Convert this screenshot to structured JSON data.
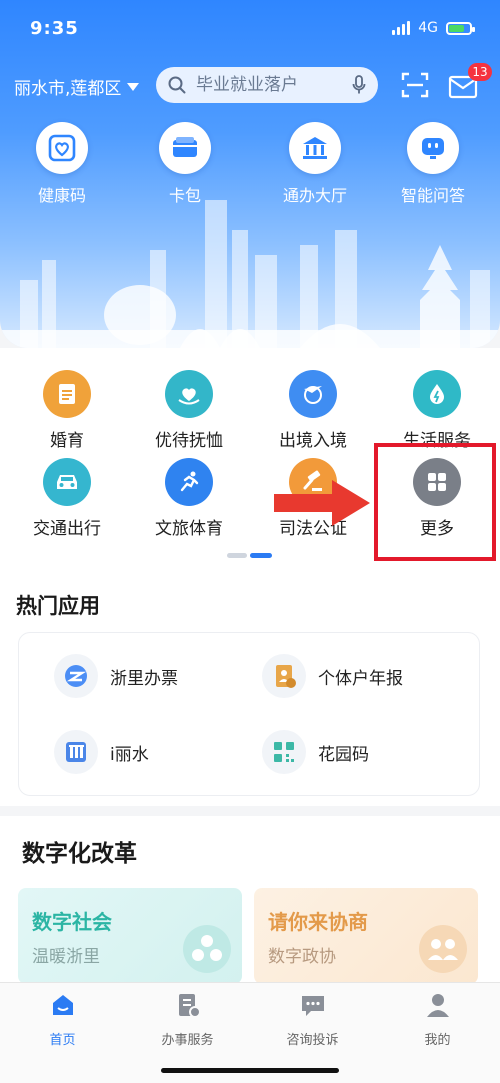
{
  "status_bar": {
    "time": "9:35",
    "network": "4G"
  },
  "header": {
    "city": "丽水市,莲都区",
    "search_placeholder": "毕业就业落户",
    "mail_badge": "13"
  },
  "quick_actions": [
    {
      "label": "健康码",
      "icon": "health-code-icon"
    },
    {
      "label": "卡包",
      "icon": "card-wallet-icon"
    },
    {
      "label": "通办大厅",
      "icon": "service-hall-icon"
    },
    {
      "label": "智能问答",
      "icon": "chatbot-icon"
    }
  ],
  "services": [
    {
      "label": "婚育",
      "icon": "marriage-icon",
      "color": "#f0a23a"
    },
    {
      "label": "优待抚恤",
      "icon": "care-heart-icon",
      "color": "#33b6c9"
    },
    {
      "label": "出境入境",
      "icon": "plane-globe-icon",
      "color": "#3f8df2"
    },
    {
      "label": "生活服务",
      "icon": "water-drop-icon",
      "color": "#2fb9c7"
    },
    {
      "label": "交通出行",
      "icon": "car-icon",
      "color": "#35b6cf"
    },
    {
      "label": "文旅体育",
      "icon": "runner-icon",
      "color": "#2f83f0"
    },
    {
      "label": "司法公证",
      "icon": "gavel-icon",
      "color": "#f29a3a"
    },
    {
      "label": "更多",
      "icon": "more-grid-icon",
      "color": "#7a7f88"
    }
  ],
  "hot_apps": {
    "title": "热门应用",
    "items": [
      {
        "label": "浙里办票",
        "icon": "invoice-icon"
      },
      {
        "label": "个体户年报",
        "icon": "annual-report-icon"
      },
      {
        "label": "i丽水",
        "icon": "ilishui-icon"
      },
      {
        "label": "花园码",
        "icon": "qr-code-icon"
      }
    ]
  },
  "reform": {
    "title": "数字化改革",
    "cards": [
      {
        "title": "数字社会",
        "subtitle": "温暖浙里"
      },
      {
        "title": "请你来协商",
        "subtitle": "数字政协"
      }
    ]
  },
  "bottom_nav": [
    {
      "label": "首页",
      "icon": "home-icon"
    },
    {
      "label": "办事服务",
      "icon": "service-doc-icon"
    },
    {
      "label": "咨询投诉",
      "icon": "chat-icon"
    },
    {
      "label": "我的",
      "icon": "profile-icon"
    }
  ],
  "colors": {
    "primary": "#2b7bf3",
    "badge": "#f5333f",
    "highlight": "#e3192b"
  }
}
